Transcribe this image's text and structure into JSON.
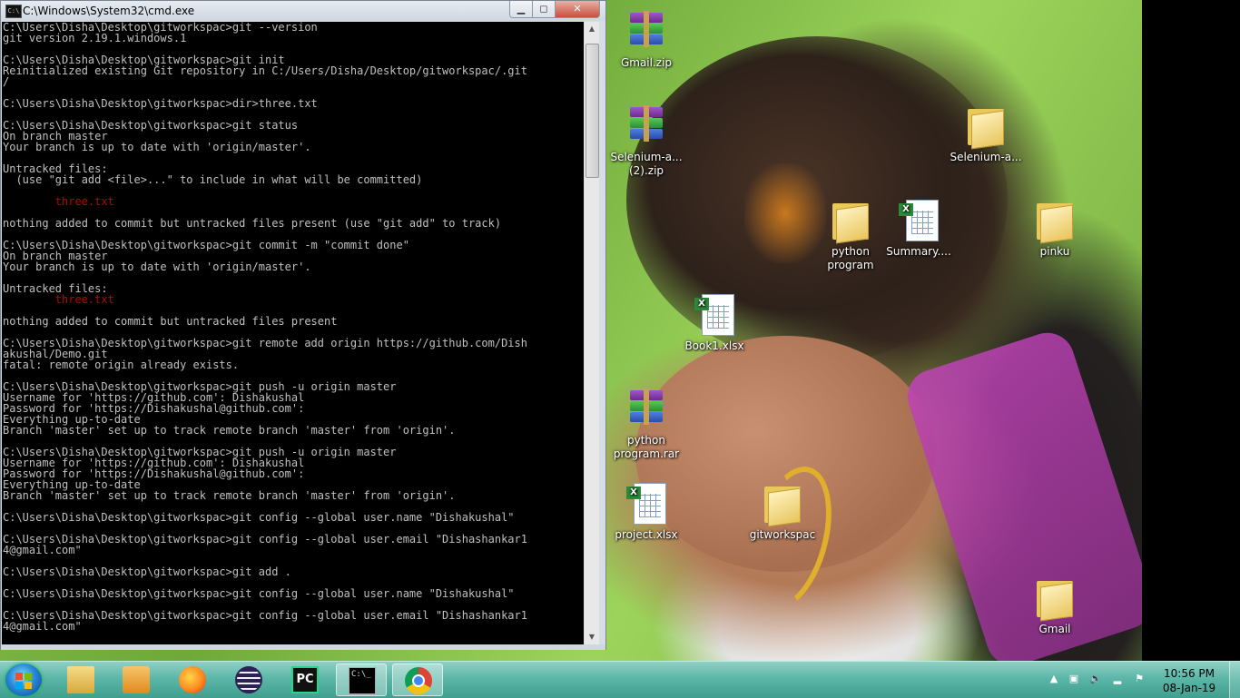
{
  "window": {
    "title": "C:\\Windows\\System32\\cmd.exe",
    "minimize": "▁",
    "maximize": "◻",
    "close": "✕"
  },
  "console": {
    "lines": [
      {
        "text": "C:\\Users\\Disha\\Desktop\\gitworkspac>git --version"
      },
      {
        "text": "git version 2.19.1.windows.1"
      },
      {
        "text": ""
      },
      {
        "text": "C:\\Users\\Disha\\Desktop\\gitworkspac>git init"
      },
      {
        "text": "Reinitialized existing Git repository in C:/Users/Disha/Desktop/gitworkspac/.git"
      },
      {
        "text": "/"
      },
      {
        "text": ""
      },
      {
        "text": "C:\\Users\\Disha\\Desktop\\gitworkspac>dir>three.txt"
      },
      {
        "text": ""
      },
      {
        "text": "C:\\Users\\Disha\\Desktop\\gitworkspac>git status"
      },
      {
        "text": "On branch master"
      },
      {
        "text": "Your branch is up to date with 'origin/master'."
      },
      {
        "text": ""
      },
      {
        "text": "Untracked files:"
      },
      {
        "text": "  (use \"git add <file>...\" to include in what will be committed)"
      },
      {
        "text": ""
      },
      {
        "text": "        three.txt",
        "color": "red"
      },
      {
        "text": ""
      },
      {
        "text": "nothing added to commit but untracked files present (use \"git add\" to track)"
      },
      {
        "text": ""
      },
      {
        "text": "C:\\Users\\Disha\\Desktop\\gitworkspac>git commit -m \"commit done\""
      },
      {
        "text": "On branch master"
      },
      {
        "text": "Your branch is up to date with 'origin/master'."
      },
      {
        "text": ""
      },
      {
        "text": "Untracked files:"
      },
      {
        "text": "        three.txt",
        "color": "red"
      },
      {
        "text": ""
      },
      {
        "text": "nothing added to commit but untracked files present"
      },
      {
        "text": ""
      },
      {
        "text": "C:\\Users\\Disha\\Desktop\\gitworkspac>git remote add origin https://github.com/Dish"
      },
      {
        "text": "akushal/Demo.git"
      },
      {
        "text": "fatal: remote origin already exists."
      },
      {
        "text": ""
      },
      {
        "text": "C:\\Users\\Disha\\Desktop\\gitworkspac>git push -u origin master"
      },
      {
        "text": "Username for 'https://github.com': Dishakushal"
      },
      {
        "text": "Password for 'https://Dishakushal@github.com':"
      },
      {
        "text": "Everything up-to-date"
      },
      {
        "text": "Branch 'master' set up to track remote branch 'master' from 'origin'."
      },
      {
        "text": ""
      },
      {
        "text": "C:\\Users\\Disha\\Desktop\\gitworkspac>git push -u origin master"
      },
      {
        "text": "Username for 'https://github.com': Dishakushal"
      },
      {
        "text": "Password for 'https://Dishakushal@github.com':"
      },
      {
        "text": "Everything up-to-date"
      },
      {
        "text": "Branch 'master' set up to track remote branch 'master' from 'origin'."
      },
      {
        "text": ""
      },
      {
        "text": "C:\\Users\\Disha\\Desktop\\gitworkspac>git config --global user.name \"Dishakushal\""
      },
      {
        "text": ""
      },
      {
        "text": "C:\\Users\\Disha\\Desktop\\gitworkspac>git config --global user.email \"Dishashankar1"
      },
      {
        "text": "4@gmail.com\""
      },
      {
        "text": ""
      },
      {
        "text": "C:\\Users\\Disha\\Desktop\\gitworkspac>git add ."
      },
      {
        "text": ""
      },
      {
        "text": "C:\\Users\\Disha\\Desktop\\gitworkspac>git config --global user.name \"Dishakushal\""
      },
      {
        "text": ""
      },
      {
        "text": "C:\\Users\\Disha\\Desktop\\gitworkspac>git config --global user.email \"Dishashankar1"
      },
      {
        "text": "4@gmail.com\""
      }
    ]
  },
  "desktop_icons": [
    {
      "id": "gmail-zip",
      "label": "Gmail.zip",
      "kind": "zip"
    },
    {
      "id": "selenium-zip",
      "label": "Selenium-a... (2).zip",
      "kind": "zip"
    },
    {
      "id": "selenium-folder",
      "label": "Selenium-a...",
      "kind": "folder"
    },
    {
      "id": "python-program",
      "label": "python program",
      "kind": "folder"
    },
    {
      "id": "summary",
      "label": "Summary....",
      "kind": "xlsx"
    },
    {
      "id": "pinku",
      "label": "pinku",
      "kind": "folder"
    },
    {
      "id": "book1",
      "label": "Book1.xlsx",
      "kind": "xlsx"
    },
    {
      "id": "python-rar",
      "label": "python program.rar",
      "kind": "zip"
    },
    {
      "id": "project",
      "label": "project.xlsx",
      "kind": "xlsx"
    },
    {
      "id": "gitworkspac",
      "label": "gitworkspac",
      "kind": "folder"
    },
    {
      "id": "gmail-folder",
      "label": "Gmail",
      "kind": "folder"
    }
  ],
  "taskbar": {
    "items": [
      {
        "name": "file-explorer",
        "icon": "folder-icon"
      },
      {
        "name": "media-player",
        "icon": "media-icon"
      },
      {
        "name": "firefox",
        "icon": "firefox-icon"
      },
      {
        "name": "eclipse",
        "icon": "eclipse-icon"
      },
      {
        "name": "pycharm",
        "icon": "pycharm-icon"
      },
      {
        "name": "cmd",
        "icon": "cmd-icon",
        "active": true
      },
      {
        "name": "chrome",
        "icon": "chrome-icon"
      }
    ],
    "pycharm_label": "PC",
    "cmd_label": "C:\\_"
  },
  "clock": {
    "time": "10:56 PM",
    "date": "08-Jan-19"
  },
  "colors": {
    "console_text": "#c0c0c0",
    "console_red": "#c00000",
    "console_bg": "#000000",
    "taskbar": "#5cb7a8"
  }
}
